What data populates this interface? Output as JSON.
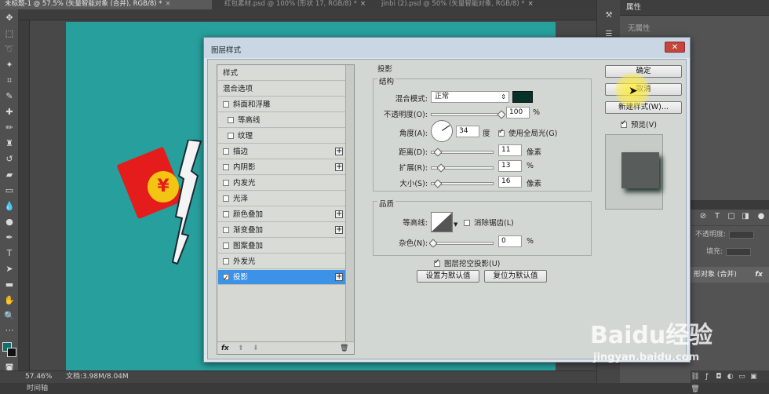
{
  "tabs": [
    {
      "label": "未标题-1 @ 57.5% (矢量智能对象 (合并), RGB/8) *",
      "close": "×"
    },
    {
      "label": "红包素材.psd @ 100% (形状 17, RGB/8) *",
      "close": "×"
    },
    {
      "label": "jinbi (2).psd @ 50% (矢量智能对象, RGB/8) *",
      "close": "×"
    }
  ],
  "canvas": {
    "background": "#279f9c",
    "yuan_glyph": "¥"
  },
  "status": {
    "zoom": "57.46%",
    "doc_size": "文档:3.98M/8.04M"
  },
  "timeline": "时间轴",
  "properties": {
    "title": "属性",
    "empty": "无属性"
  },
  "layers": {
    "opacity_label": "不透明度:",
    "fill_label": "填充:",
    "active_layer": "形对象 (合并)",
    "fx": "fx"
  },
  "dialog": {
    "title": "图层样式",
    "close": "✕",
    "style_list": {
      "items": [
        {
          "label": "样式",
          "checkbox": false,
          "checked": false,
          "plus": false,
          "indent": false
        },
        {
          "label": "混合选项",
          "checkbox": false,
          "checked": false,
          "plus": false,
          "indent": false
        },
        {
          "label": "斜面和浮雕",
          "checkbox": true,
          "checked": false,
          "plus": false,
          "indent": false
        },
        {
          "label": "等高线",
          "checkbox": true,
          "checked": false,
          "plus": false,
          "indent": true
        },
        {
          "label": "纹理",
          "checkbox": true,
          "checked": false,
          "plus": false,
          "indent": true
        },
        {
          "label": "描边",
          "checkbox": true,
          "checked": false,
          "plus": true,
          "indent": false
        },
        {
          "label": "内阴影",
          "checkbox": true,
          "checked": false,
          "plus": true,
          "indent": false
        },
        {
          "label": "内发光",
          "checkbox": true,
          "checked": false,
          "plus": false,
          "indent": false
        },
        {
          "label": "光泽",
          "checkbox": true,
          "checked": false,
          "plus": false,
          "indent": false
        },
        {
          "label": "颜色叠加",
          "checkbox": true,
          "checked": false,
          "plus": true,
          "indent": false
        },
        {
          "label": "渐变叠加",
          "checkbox": true,
          "checked": false,
          "plus": true,
          "indent": false
        },
        {
          "label": "图案叠加",
          "checkbox": true,
          "checked": false,
          "plus": false,
          "indent": false
        },
        {
          "label": "外发光",
          "checkbox": true,
          "checked": false,
          "plus": false,
          "indent": false
        },
        {
          "label": "投影",
          "checkbox": true,
          "checked": true,
          "plus": true,
          "indent": false,
          "active": true
        }
      ],
      "footer": {
        "fx": "fx",
        "up": "⬆",
        "down": "⬇",
        "trash": "🗑"
      }
    },
    "drop_shadow": {
      "section_title": "投影",
      "structure_label": "结构",
      "blend_mode_label": "混合模式:",
      "blend_mode_value": "正常",
      "shadow_color": "#063329",
      "opacity_label": "不透明度(O):",
      "opacity_value": "100",
      "opacity_unit": "%",
      "opacity_percent": 100,
      "angle_label": "角度(A):",
      "angle_value": "34",
      "angle_unit": "度",
      "global_light_label": "使用全局光(G)",
      "global_light_checked": true,
      "distance_label": "距离(D):",
      "distance_value": "11",
      "distance_unit": "像素",
      "spread_label": "扩展(R):",
      "spread_value": "13",
      "spread_unit": "%",
      "size_label": "大小(S):",
      "size_value": "16",
      "size_unit": "像素",
      "quality_label": "品质",
      "contour_label": "等高线:",
      "antialias_label": "消除锯齿(L)",
      "antialias_checked": false,
      "noise_label": "杂色(N):",
      "noise_value": "0",
      "noise_unit": "%",
      "knockout_label": "图层挖空投影(U)",
      "knockout_checked": true,
      "set_default_button": "设置为默认值",
      "reset_default_button": "复位为默认值"
    },
    "buttons": {
      "ok": "确定",
      "cancel": "取消",
      "new_style": "新建样式(W)...",
      "preview_label": "预览(V)",
      "preview_checked": true
    }
  },
  "watermark": {
    "main": "Baidu经验",
    "sub": "jingyan.baidu.com"
  }
}
